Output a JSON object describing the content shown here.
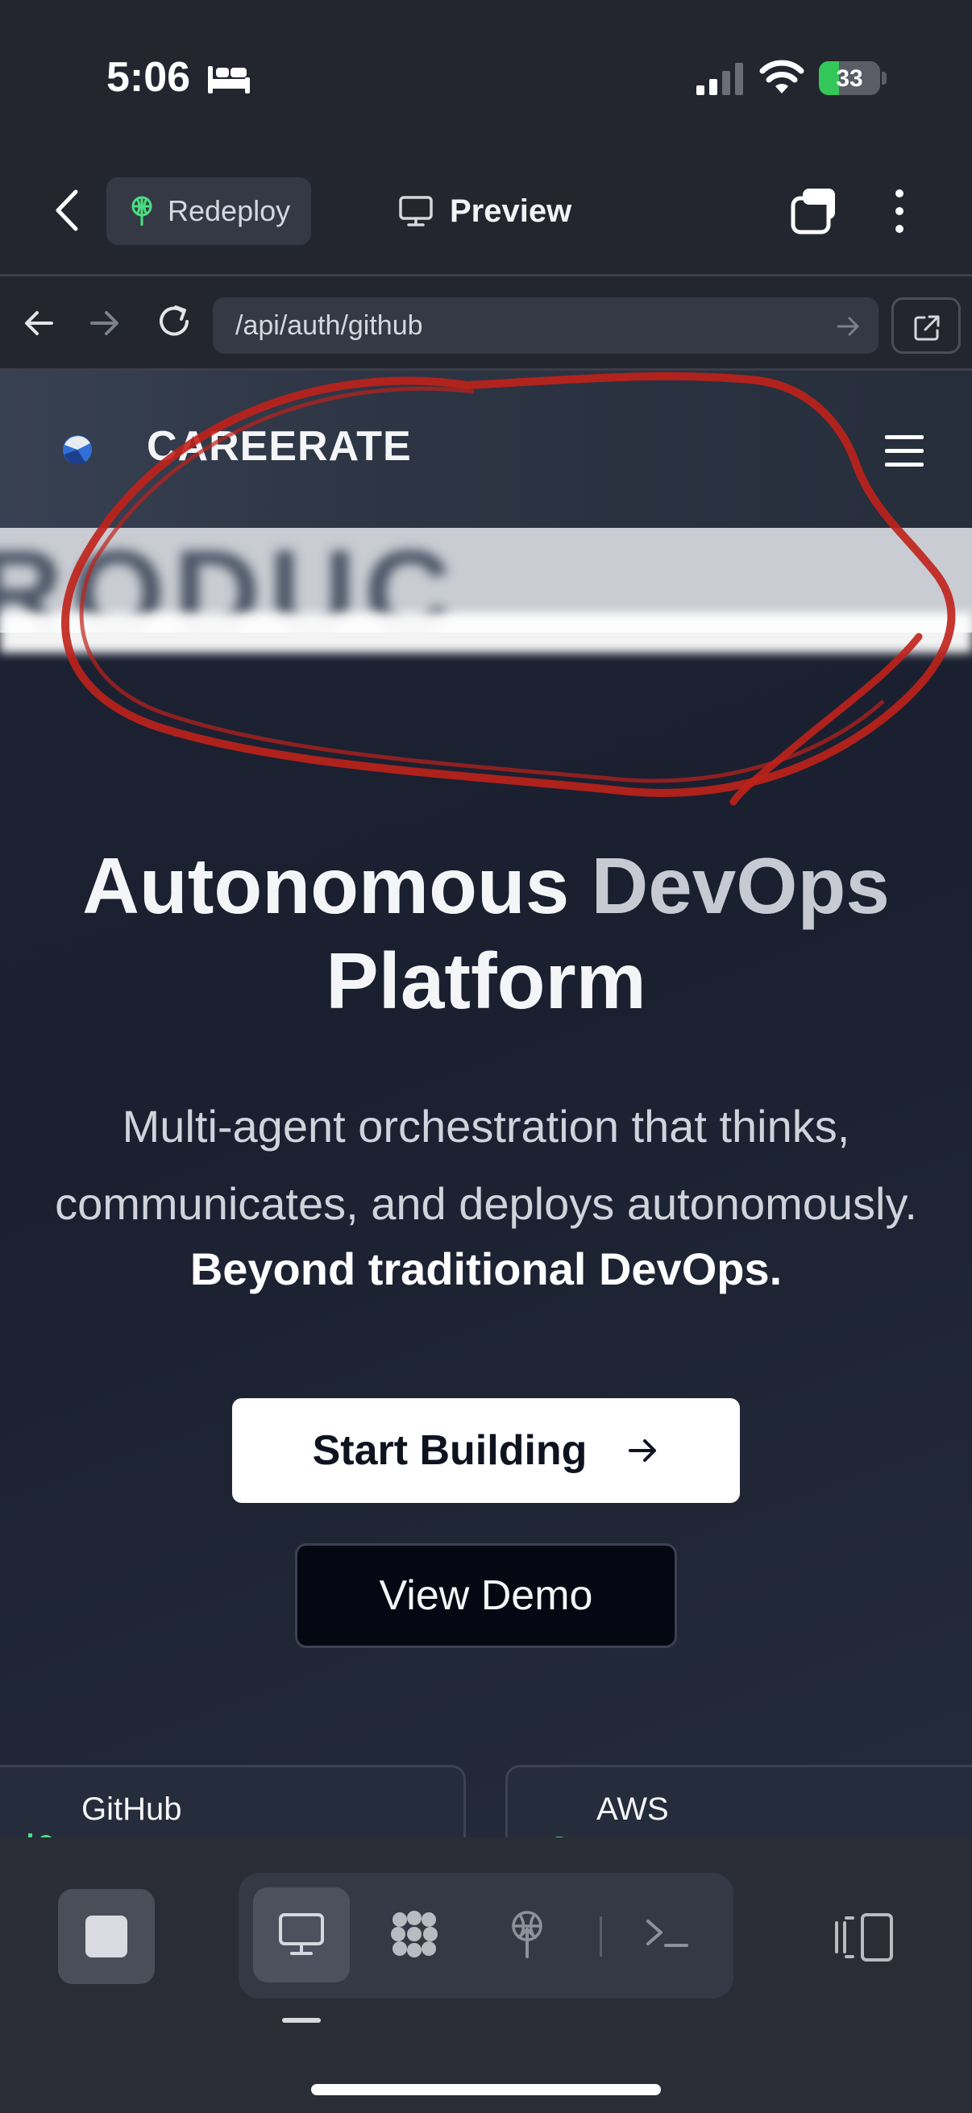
{
  "status_bar": {
    "time": "5:06",
    "battery_percent": "33",
    "battery_level": 0.33
  },
  "header": {
    "redeploy_label": "Redeploy",
    "title": "Preview"
  },
  "browser": {
    "url": "/api/auth/github"
  },
  "site": {
    "brand": "CAREERATE",
    "blurred_banner": "RODUC",
    "hero_title_main": "Autonomous ",
    "hero_title_accent": "DevOps",
    "hero_title_line2": "Platform",
    "hero_subtitle": "Multi-agent orchestration that thinks, communicates, and deploys autonomously.",
    "hero_strong": "Beyond traditional DevOps.",
    "primary_cta": "Start Building",
    "secondary_cta": "View Demo",
    "cards": [
      {
        "label": "GitHub"
      },
      {
        "label": "AWS"
      }
    ]
  },
  "colors": {
    "accent_red": "#c0211a",
    "battery_green": "#34c759",
    "redeploy_green": "#4ade80"
  }
}
